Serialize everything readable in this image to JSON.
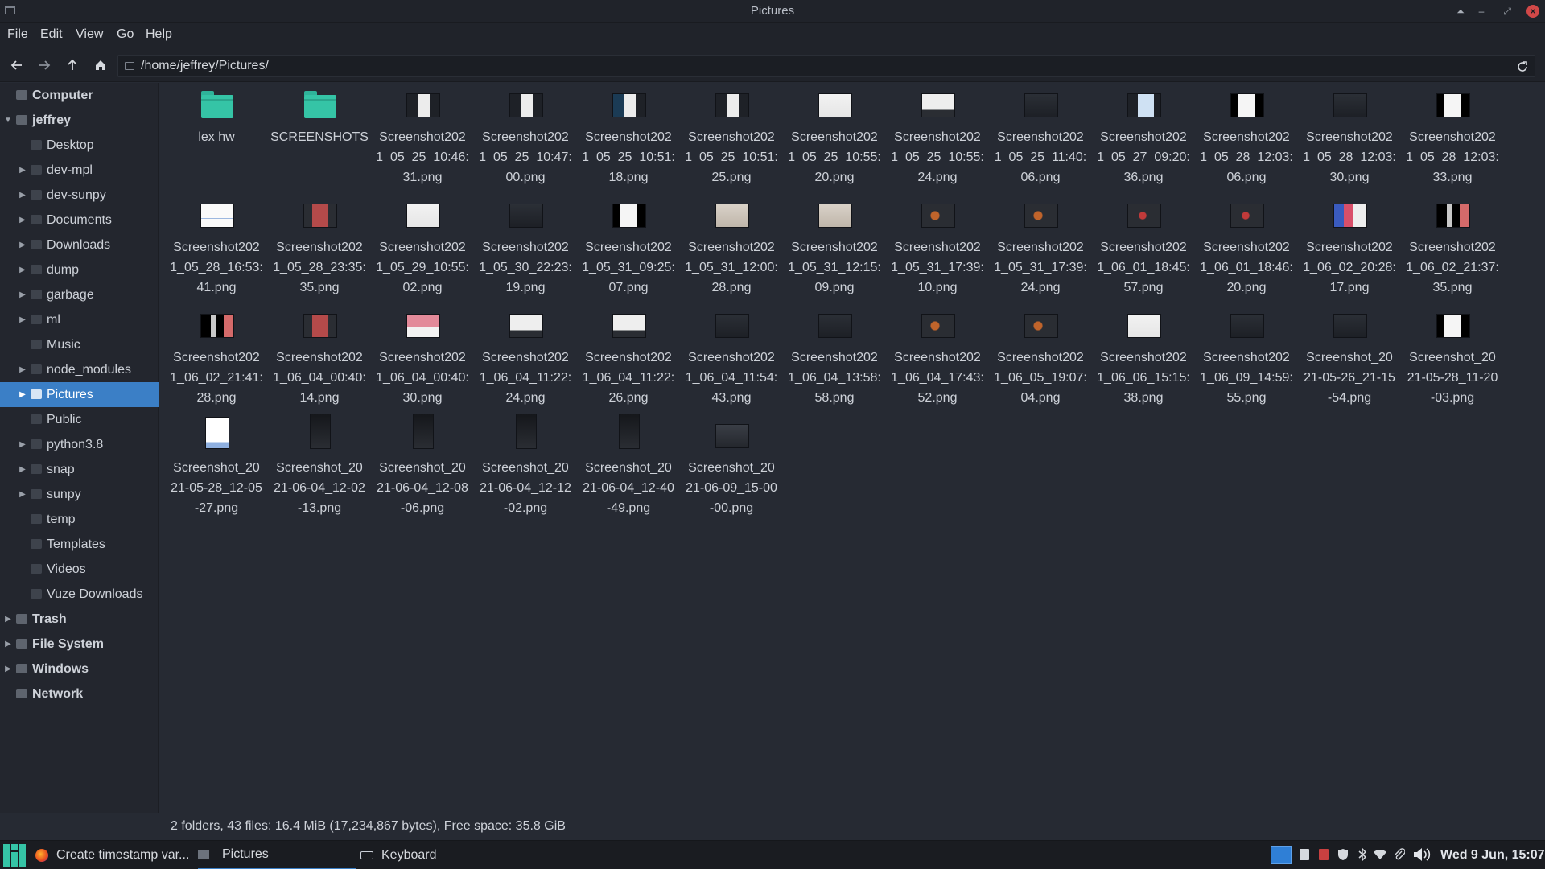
{
  "window": {
    "title": "Pictures"
  },
  "menu": [
    "File",
    "Edit",
    "View",
    "Go",
    "Help"
  ],
  "path": "/home/jeffrey/Pictures/",
  "sidebar": [
    {
      "label": "Computer",
      "level": 0,
      "bold": true,
      "arrow": "",
      "icon": "computer-icon"
    },
    {
      "label": "jeffrey",
      "level": 0,
      "bold": true,
      "arrow": "down",
      "icon": "home-icon"
    },
    {
      "label": "Desktop",
      "level": 1,
      "arrow": "",
      "icon": "folder-icon"
    },
    {
      "label": "dev-mpl",
      "level": 1,
      "arrow": "right",
      "icon": "folder-icon"
    },
    {
      "label": "dev-sunpy",
      "level": 1,
      "arrow": "right",
      "icon": "folder-icon"
    },
    {
      "label": "Documents",
      "level": 1,
      "arrow": "right",
      "icon": "folder-icon"
    },
    {
      "label": "Downloads",
      "level": 1,
      "arrow": "right",
      "icon": "download-icon"
    },
    {
      "label": "dump",
      "level": 1,
      "arrow": "right",
      "icon": "folder-icon"
    },
    {
      "label": "garbage",
      "level": 1,
      "arrow": "right",
      "icon": "folder-icon"
    },
    {
      "label": "ml",
      "level": 1,
      "arrow": "right",
      "icon": "folder-icon"
    },
    {
      "label": "Music",
      "level": 1,
      "arrow": "",
      "icon": "music-icon"
    },
    {
      "label": "node_modules",
      "level": 1,
      "arrow": "right",
      "icon": "folder-icon"
    },
    {
      "label": "Pictures",
      "level": 1,
      "arrow": "right",
      "icon": "pictures-icon",
      "selected": true
    },
    {
      "label": "Public",
      "level": 1,
      "arrow": "",
      "icon": "public-icon"
    },
    {
      "label": "python3.8",
      "level": 1,
      "arrow": "right",
      "icon": "folder-icon"
    },
    {
      "label": "snap",
      "level": 1,
      "arrow": "right",
      "icon": "folder-icon"
    },
    {
      "label": "sunpy",
      "level": 1,
      "arrow": "right",
      "icon": "folder-icon"
    },
    {
      "label": "temp",
      "level": 1,
      "arrow": "",
      "icon": "folder-icon"
    },
    {
      "label": "Templates",
      "level": 1,
      "arrow": "",
      "icon": "templates-icon"
    },
    {
      "label": "Videos",
      "level": 1,
      "arrow": "",
      "icon": "videos-icon"
    },
    {
      "label": "Vuze Downloads",
      "level": 1,
      "arrow": "",
      "icon": "folder-icon"
    },
    {
      "label": "Trash",
      "level": 0,
      "bold": true,
      "arrow": "right",
      "icon": "trash-icon"
    },
    {
      "label": "File System",
      "level": 0,
      "bold": true,
      "arrow": "right",
      "icon": "drive-icon"
    },
    {
      "label": "Windows",
      "level": 0,
      "bold": true,
      "arrow": "right",
      "icon": "drive-icon"
    },
    {
      "label": "Network",
      "level": 0,
      "bold": true,
      "arrow": "",
      "icon": "network-icon"
    }
  ],
  "files": [
    {
      "lines": [
        "lex hw"
      ],
      "type": "folder"
    },
    {
      "lines": [
        "SCREENSHOTS"
      ],
      "type": "folder"
    },
    {
      "lines": [
        "Screenshot202",
        "1_05_25_10:46:",
        "31.png"
      ],
      "thumb": "dark-white"
    },
    {
      "lines": [
        "Screenshot202",
        "1_05_25_10:47:",
        "00.png"
      ],
      "thumb": "dark-white"
    },
    {
      "lines": [
        "Screenshot202",
        "1_05_25_10:51:",
        "18.png"
      ],
      "thumb": "blue-white"
    },
    {
      "lines": [
        "Screenshot202",
        "1_05_25_10:51:",
        "25.png"
      ],
      "thumb": "dark-white"
    },
    {
      "lines": [
        "Screenshot202",
        "1_05_25_10:55:",
        "20.png"
      ],
      "thumb": "white"
    },
    {
      "lines": [
        "Screenshot202",
        "1_05_25_10:55:",
        "24.png"
      ],
      "thumb": "white-dark"
    },
    {
      "lines": [
        "Screenshot202",
        "1_05_25_11:40:",
        "06.png"
      ],
      "thumb": "dark"
    },
    {
      "lines": [
        "Screenshot202",
        "1_05_27_09:20:",
        "36.png"
      ],
      "thumb": "dark-blue"
    },
    {
      "lines": [
        "Screenshot202",
        "1_05_28_12:03:",
        "06.png"
      ],
      "thumb": "black-white"
    },
    {
      "lines": [
        "Screenshot202",
        "1_05_28_12:03:",
        "30.png"
      ],
      "thumb": "dark"
    },
    {
      "lines": [
        "Screenshot202",
        "1_05_28_12:03:",
        "33.png"
      ],
      "thumb": "black-white"
    },
    {
      "lines": [
        "Screenshot202",
        "1_05_28_16:53:",
        "41.png"
      ],
      "thumb": "white-blue"
    },
    {
      "lines": [
        "Screenshot202",
        "1_05_28_23:35:",
        "35.png"
      ],
      "thumb": "red-dark"
    },
    {
      "lines": [
        "Screenshot202",
        "1_05_29_10:55:",
        "02.png"
      ],
      "thumb": "white"
    },
    {
      "lines": [
        "Screenshot202",
        "1_05_30_22:23:",
        "19.png"
      ],
      "thumb": "dark"
    },
    {
      "lines": [
        "Screenshot202",
        "1_05_31_09:25:",
        "07.png"
      ],
      "thumb": "black-white"
    },
    {
      "lines": [
        "Screenshot202",
        "1_05_31_12:00:",
        "28.png"
      ],
      "thumb": "beige"
    },
    {
      "lines": [
        "Screenshot202",
        "1_05_31_12:15:",
        "09.png"
      ],
      "thumb": "beige"
    },
    {
      "lines": [
        "Screenshot202",
        "1_05_31_17:39:",
        "10.png"
      ],
      "thumb": "dark-orange"
    },
    {
      "lines": [
        "Screenshot202",
        "1_05_31_17:39:",
        "24.png"
      ],
      "thumb": "dark-orange"
    },
    {
      "lines": [
        "Screenshot202",
        "1_06_01_18:45:",
        "57.png"
      ],
      "thumb": "dark-red"
    },
    {
      "lines": [
        "Screenshot202",
        "1_06_01_18:46:",
        "20.png"
      ],
      "thumb": "dark-red"
    },
    {
      "lines": [
        "Screenshot202",
        "1_06_02_20:28:",
        "17.png"
      ],
      "thumb": "colorful"
    },
    {
      "lines": [
        "Screenshot202",
        "1_06_02_21:37:",
        "35.png"
      ],
      "thumb": "black-color"
    },
    {
      "lines": [
        "Screenshot202",
        "1_06_02_21:41:",
        "28.png"
      ],
      "thumb": "black-color"
    },
    {
      "lines": [
        "Screenshot202",
        "1_06_04_00:40:",
        "14.png"
      ],
      "thumb": "red-dark"
    },
    {
      "lines": [
        "Screenshot202",
        "1_06_04_00:40:",
        "30.png"
      ],
      "thumb": "pink"
    },
    {
      "lines": [
        "Screenshot202",
        "1_06_04_11:22:",
        "24.png"
      ],
      "thumb": "white-dark"
    },
    {
      "lines": [
        "Screenshot202",
        "1_06_04_11:22:",
        "26.png"
      ],
      "thumb": "white-dark"
    },
    {
      "lines": [
        "Screenshot202",
        "1_06_04_11:54:",
        "43.png"
      ],
      "thumb": "dark"
    },
    {
      "lines": [
        "Screenshot202",
        "1_06_04_13:58:",
        "58.png"
      ],
      "thumb": "dark"
    },
    {
      "lines": [
        "Screenshot202",
        "1_06_04_17:43:",
        "52.png"
      ],
      "thumb": "dark-orange"
    },
    {
      "lines": [
        "Screenshot202",
        "1_06_05_19:07:",
        "04.png"
      ],
      "thumb": "dark-orange"
    },
    {
      "lines": [
        "Screenshot202",
        "1_06_06_15:15:",
        "38.png"
      ],
      "thumb": "white"
    },
    {
      "lines": [
        "Screenshot202",
        "1_06_09_14:59:",
        "55.png"
      ],
      "thumb": "dark"
    },
    {
      "lines": [
        "Screenshot_20",
        "21-05-26_21-15",
        "-54.png"
      ],
      "thumb": "dark"
    },
    {
      "lines": [
        "Screenshot_20",
        "21-05-28_11-20",
        "-03.png"
      ],
      "thumb": "black-white"
    },
    {
      "lines": [
        "Screenshot_20",
        "21-05-28_12-05",
        "-27.png"
      ],
      "thumb": "doc"
    },
    {
      "lines": [
        "Screenshot_20",
        "21-06-04_12-02",
        "-13.png"
      ],
      "thumb": "terminal"
    },
    {
      "lines": [
        "Screenshot_20",
        "21-06-04_12-08",
        "-06.png"
      ],
      "thumb": "terminal"
    },
    {
      "lines": [
        "Screenshot_20",
        "21-06-04_12-12",
        "-02.png"
      ],
      "thumb": "terminal"
    },
    {
      "lines": [
        "Screenshot_20",
        "21-06-04_12-40",
        "-49.png"
      ],
      "thumb": "terminal"
    },
    {
      "lines": [
        "Screenshot_20",
        "21-06-09_15-00",
        "-00.png"
      ],
      "thumb": "dark-wide"
    }
  ],
  "status": "2 folders, 43 files: 16.4 MiB (17,234,867 bytes), Free space: 35.8 GiB",
  "taskbar": {
    "tasks": [
      {
        "label": "Create timestamp var...",
        "icon": "firefox-icon"
      },
      {
        "label": "Pictures",
        "icon": "folder-icon",
        "active": true
      },
      {
        "label": "Keyboard",
        "icon": "keyboard-icon"
      }
    ],
    "clock": "Wed 9 Jun, 15:07"
  },
  "colors": {
    "accent": "#3b7fc6",
    "folder": "#35c4a6",
    "background": "#262a33"
  }
}
